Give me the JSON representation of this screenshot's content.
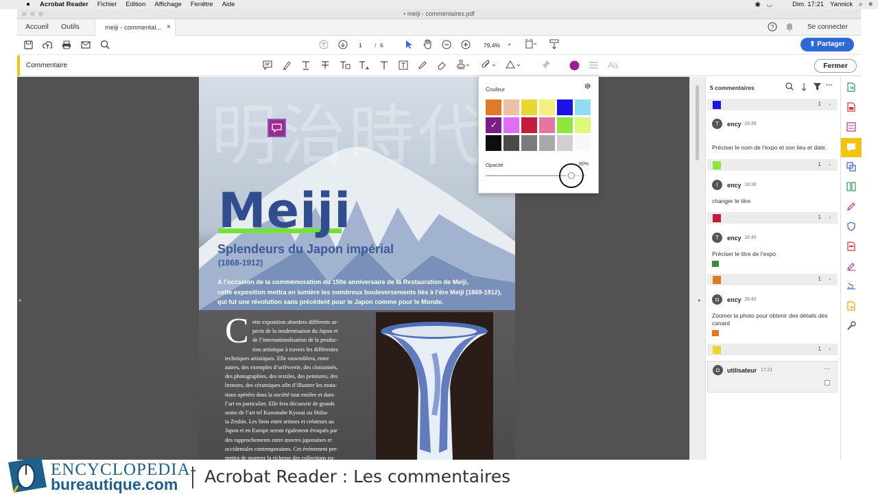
{
  "menubar": {
    "app_name": "Acrobat Reader",
    "menus": [
      "Fichier",
      "Edition",
      "Affichage",
      "Fenêtre",
      "Aide"
    ],
    "clock": "Dim. 17:21",
    "user": "Yannick"
  },
  "window": {
    "title": "meiji - commentaires.pdf"
  },
  "tabs": {
    "home": "Accueil",
    "tools": "Outils",
    "document": "meiji - commentai...",
    "close_glyph": "×",
    "sign_in": "Se connecter"
  },
  "toolbar": {
    "page_current": "1",
    "page_sep": "/",
    "page_total": "6",
    "zoom": "79,4%",
    "share": "Partager"
  },
  "comment_toolbar": {
    "label": "Commentaire",
    "text_style_glyph": "Aa",
    "close": "Fermer",
    "accent": "#f1c40f"
  },
  "color_popover": {
    "title": "Couleur",
    "opacity_label": "Opacité",
    "opacity_value": "80%",
    "opacity": 0.8,
    "selected_index": 6,
    "check_glyph": "✓",
    "colors": [
      "#e07a26",
      "#ebc0a4",
      "#e8d733",
      "#f3f07e",
      "#1b13e8",
      "#8fdcf7",
      "#7d1d86",
      "#de6ef5",
      "#c21c3a",
      "#e575a3",
      "#8ee83b",
      "#dcf97a",
      "#0d0d0d",
      "#4a4a4a",
      "#7b7b7b",
      "#a9a9a9",
      "#d0d0d0",
      "#f8f8f8"
    ]
  },
  "document": {
    "kanji": "明治時代",
    "title": "Meiji",
    "subtitle": "Splendeurs du Japon impérial",
    "dates": "(1868-1912)",
    "intro_lines": [
      "A l’occasion de la commémoration du 150e anniversaire de la Restauration de Meiji,",
      "cette exposition mettra en lumière les nombreux bouleversements liés à l’ère Meiji (1868-1912),",
      "qui fut une révolution sans précédent pour le Japon comme pour le Monde."
    ],
    "dropcap": "C",
    "body_lines": [
      "ette exposition abordera différents as-",
      "pects de la modernisation du Japon et",
      "de l’internationalisation de la produc-",
      "tion artistique à travers les différentes",
      "techniques artistiques. Elle rassemblera, entre",
      "autres, des exemples d’orfèvrerie, des cloisonnés,",
      "des photographies, des textiles, des peintures, des",
      "bronzes, des céramiques afin d’illustrer les muta-",
      "tions opérées dans la société tout entière et dans",
      "l’art en particulier. Elle fera découvrir de grands",
      "noms de l’art tel Kawanabe Kyosai ou Shiba-",
      "ta Zeshin. Les liens entre artistes et créateurs au",
      "Japon et en Europe seront également évoqués par",
      "des rapprochements entre œuvres japonaises et",
      "occidentales contemporaines. Cet événement per-",
      "mettra de montrer la richesse des collections eu-"
    ]
  },
  "comments_panel": {
    "count_label": "5 commentaires",
    "groups": [
      {
        "color": "#1b13e8",
        "count": "1",
        "author": "ency",
        "time": "16:39",
        "text": "Préciser le nom de l’expo et son lieu et date.",
        "avatar": "T"
      },
      {
        "color": "#8ee83b",
        "count": "1",
        "author": "ency",
        "time": "16:38",
        "text": "changer le titre",
        "avatar": "I"
      },
      {
        "color": "#c21c3a",
        "count": "1",
        "author": "ency",
        "time": "16:40",
        "text": "Préciser le titre de l’expo",
        "avatar": "T"
      },
      {
        "color": "#e07a26",
        "count": "1",
        "author": "ency",
        "time": "16:40",
        "text": "Zoomer la photo pour obtenir des détails des canard",
        "avatar": "◘"
      },
      {
        "color": "#e8d733",
        "count": "1",
        "author": "utilisateur",
        "time": "17:21",
        "text": "",
        "avatar": "◘"
      }
    ],
    "more_glyph": "···"
  },
  "banner": {
    "brand_top": "ENCYCLOPEDIA-",
    "brand_bottom": "bureautique.com",
    "title": "Acrobat Reader : Les commentaires"
  }
}
